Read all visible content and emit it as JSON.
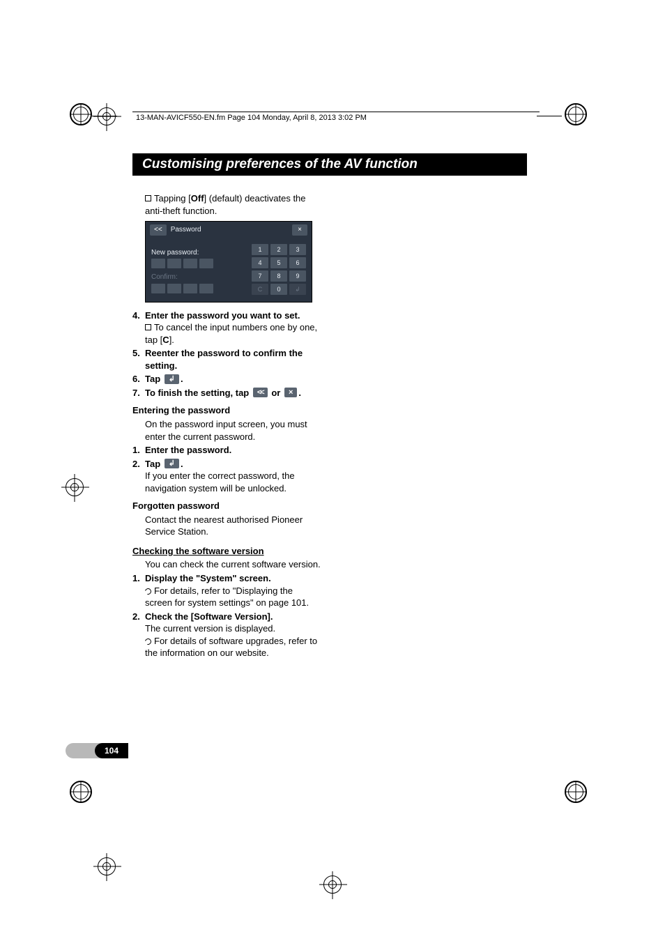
{
  "header_line": "13-MAN-AVICF550-EN.fm  Page 104  Monday, April 8, 2013  3:02 PM",
  "section_title": "Customising preferences of the AV function",
  "intro_a": "Tapping [",
  "intro_off": "Off",
  "intro_b": "] (default) deactivates the anti-theft function.",
  "shot": {
    "back": "<<",
    "title": "Password",
    "close": "×",
    "lbl_new": "New password:",
    "lbl_confirm": "Confirm:",
    "keys": [
      "1",
      "2",
      "3",
      "4",
      "5",
      "6",
      "7",
      "8",
      "9",
      "C",
      "0",
      "↲"
    ]
  },
  "s4_num": "4.",
  "s4_title": "Enter the password you want to set.",
  "s4_body_a": "To cancel the input numbers one by one, tap [",
  "s4_body_c": "C",
  "s4_body_b": "].",
  "s5_num": "5.",
  "s5_title": "Reenter the password to confirm the setting.",
  "s6_num": "6.",
  "s6_title_a": "Tap ",
  "s6_title_b": ".",
  "s7_num": "7.",
  "s7_title_a": "To finish the setting, tap ",
  "s7_or": " or ",
  "s7_title_b": ".",
  "h_enter": "Entering the password",
  "enter_body": "On the password input screen, you must enter the current password.",
  "e1_num": "1.",
  "e1_title": "Enter the password.",
  "e2_num": "2.",
  "e2_title_a": "Tap ",
  "e2_title_b": ".",
  "e2_body": "If you enter the correct password, the navigation system will be unlocked.",
  "h_forgot": "Forgotten password",
  "forgot_body": "Contact the nearest authorised Pioneer Service Station.",
  "h_check": "Checking the software version",
  "check_body": "You can check the current software version.",
  "c1_num": "1.",
  "c1_title": "Display the \"System\" screen.",
  "c1_body": "For details, refer to \"Displaying the screen for system settings\" on page 101.",
  "c2_num": "2.",
  "c2_title": "Check the [Software Version].",
  "c2_line": "The current version is displayed.",
  "c2_body": "For details of software upgrades, refer to the information on our website.",
  "pagenum": "104"
}
